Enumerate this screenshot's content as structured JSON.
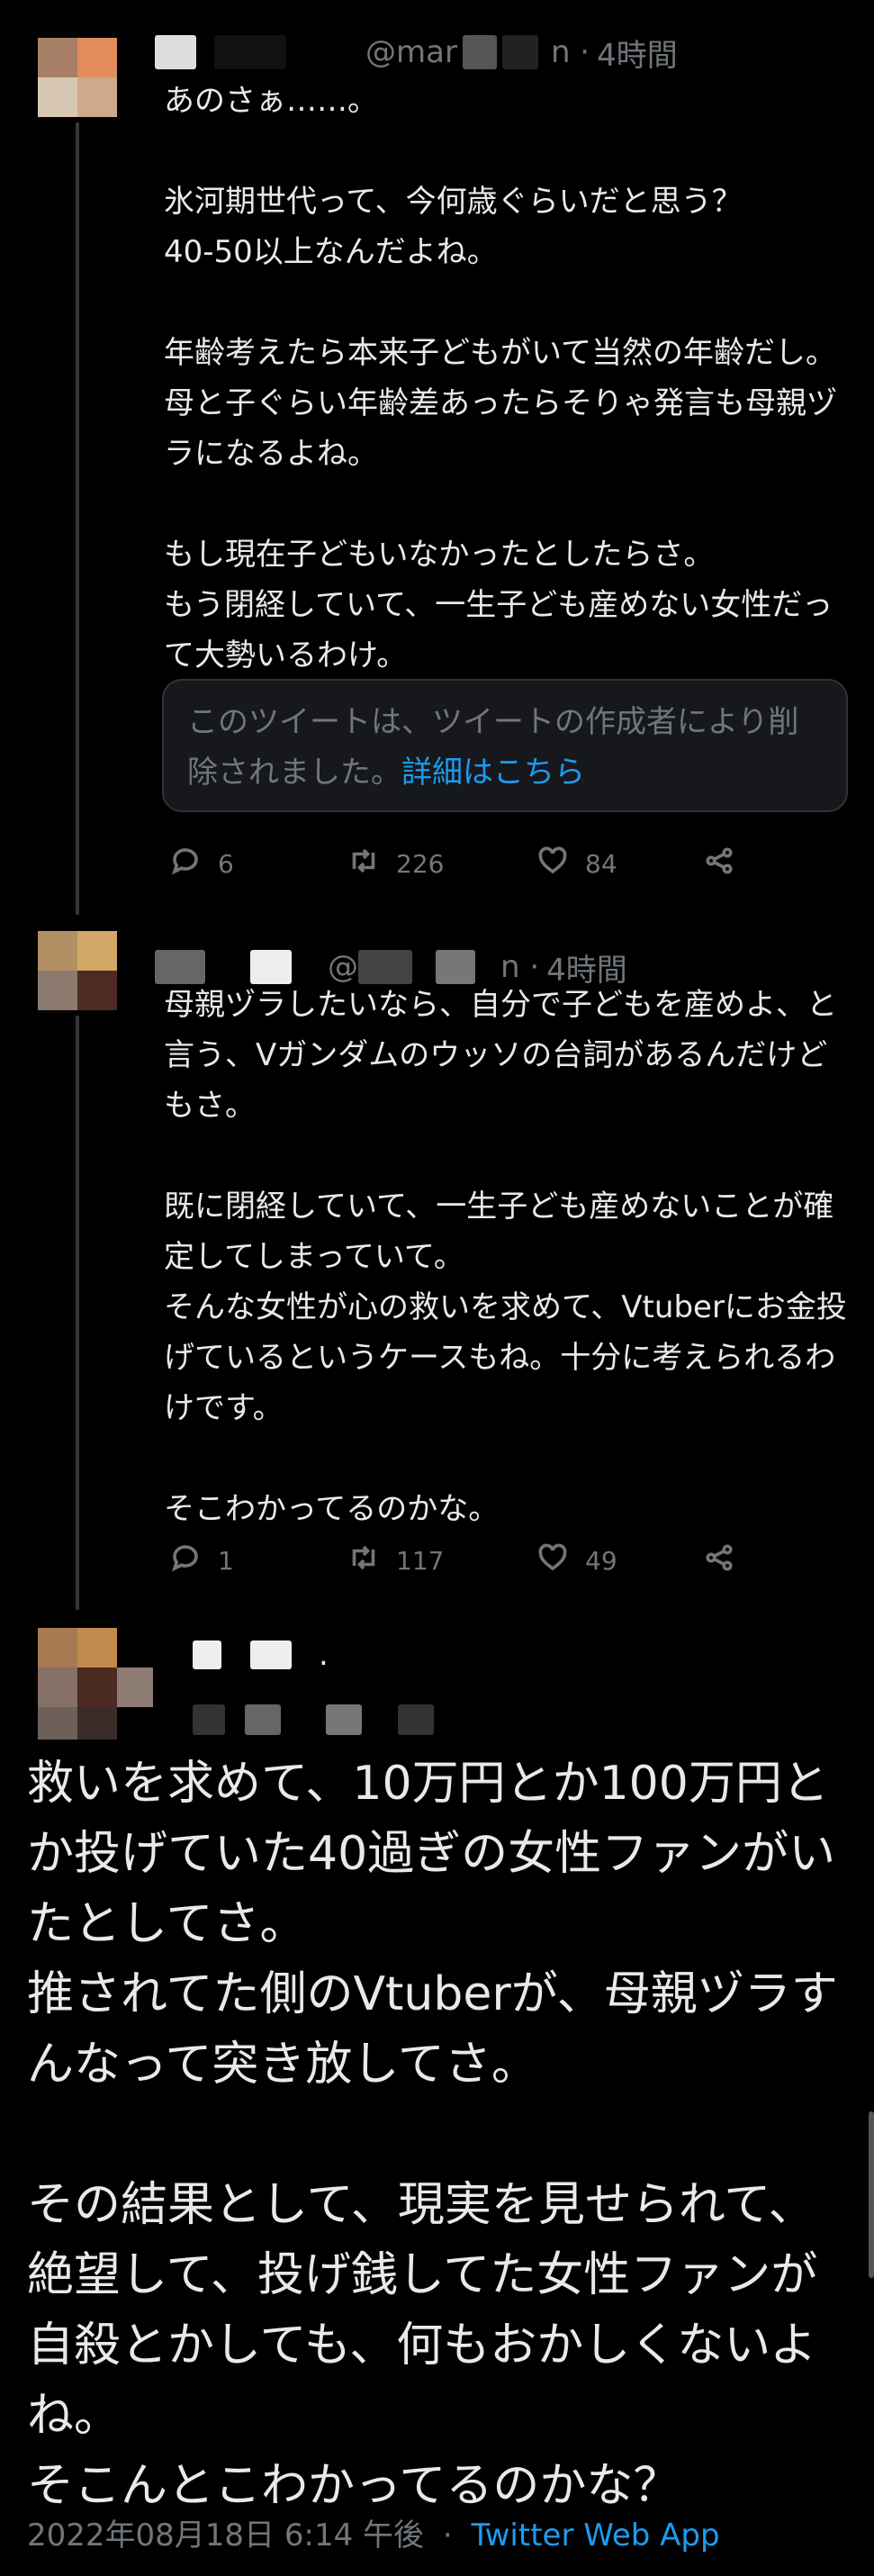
{
  "tweets": [
    {
      "handle": "@mar",
      "time": "4時間",
      "text": "あのさぁ……。\n\n氷河期世代って、今何歳ぐらいだと思う？\n40-50以上なんだよね。\n\n年齢考えたら本来子どもがいて当然の年齢だし。母と子ぐらい年齢差あったらそりゃ発言も母親ヅラになるよね。\n\nもし現在子どもいなかったとしたらさ。\nもう閉経していて、一生子ども産めない女性だって大勢いるわけ。",
      "deleted_notice": "このツイートは、ツイートの作成者により削除されました。",
      "deleted_link": "詳細はこちら",
      "replies": "6",
      "retweets": "226",
      "likes": "84"
    },
    {
      "handle": "@",
      "time": "4時間",
      "text": "母親ヅラしたいなら、自分で子どもを産めよ、と言う、Vガンダムのウッソの台詞があるんだけどもさ。\n\n既に閉経していて、一生子ども産めないことが確定してしまっていて。\nそんな女性が心の救いを求めて、Vtuberにお金投げているというケースもね。十分に考えられるわけです。\n\nそこわかってるのかな。",
      "replies": "1",
      "retweets": "117",
      "likes": "49"
    }
  ],
  "main_tweet": {
    "name_suffix": ".",
    "text": "救いを求めて、10万円とか100万円とか投げていた40過ぎの女性ファンがいたとしてさ。\n推されてた側のVtuberが、母親ヅラすんなって突き放してさ。\n\nその結果として、現実を見せられて、絶望して、投げ銭してた女性ファンが自殺とかしても、何もおかしくないよね。\nそこんとこわかってるのかな？",
    "timestamp": "2022年08月18日 6:14 午後",
    "separator": "·",
    "source": "Twitter Web App"
  },
  "icons": [
    "reply-icon",
    "retweet-icon",
    "like-icon",
    "share-icon"
  ],
  "colors": {
    "background": "#000000",
    "text": "#e7e9ea",
    "muted": "#71767b",
    "link": "#1d9bf0"
  }
}
